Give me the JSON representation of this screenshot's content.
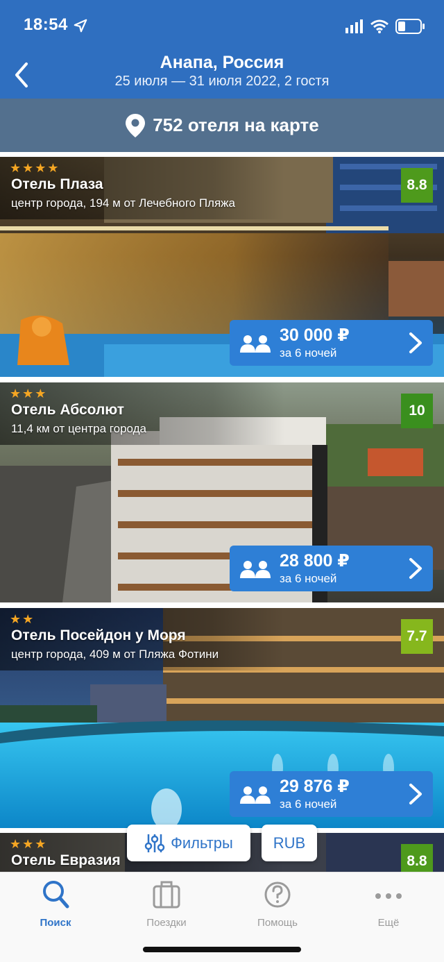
{
  "status_bar": {
    "time": "18:54"
  },
  "header": {
    "title": "Анапа, Россия",
    "subtitle": "25 июля — 31 июля 2022, 2 гостя"
  },
  "map_banner": {
    "label": "752 отеля на карте"
  },
  "hotels": [
    {
      "stars": "★★★★",
      "name": "Отель Плаза",
      "location": "центр города, 194 м от Лечебного Пляжа",
      "rating": "8.8",
      "rating_color": "#4e9a1c",
      "price": "30 000 ₽",
      "price_note": "за 6 ночей"
    },
    {
      "stars": "★★★",
      "name": "Отель Абсолют",
      "location": "11,4 км от центра города",
      "rating": "10",
      "rating_color": "#3a8f1e",
      "price": "28 800 ₽",
      "price_note": "за 6 ночей"
    },
    {
      "stars": "★★",
      "name": "Отель Посейдон у Моря",
      "location": "центр города, 409 м от Пляжа Фотини",
      "rating": "7.7",
      "rating_color": "#86b71d",
      "price": "29 876 ₽",
      "price_note": "за 6 ночей"
    },
    {
      "stars": "★★★",
      "name": "Отель Евразия",
      "rating": "8.8",
      "rating_color": "#4e9a1c"
    }
  ],
  "floating": {
    "filters_label": "Фильтры",
    "currency_label": "RUB"
  },
  "tabs": [
    {
      "label": "Поиск",
      "icon": "search-icon",
      "active": true
    },
    {
      "label": "Поездки",
      "icon": "suitcase-icon",
      "active": false
    },
    {
      "label": "Помощь",
      "icon": "help-icon",
      "active": false
    },
    {
      "label": "Ещё",
      "icon": "more-icon",
      "active": false
    }
  ],
  "colors": {
    "accent": "#2f6fc0",
    "map_banner": "#53708e",
    "price_button": "#2e7fd6",
    "stars": "#f5a623"
  }
}
